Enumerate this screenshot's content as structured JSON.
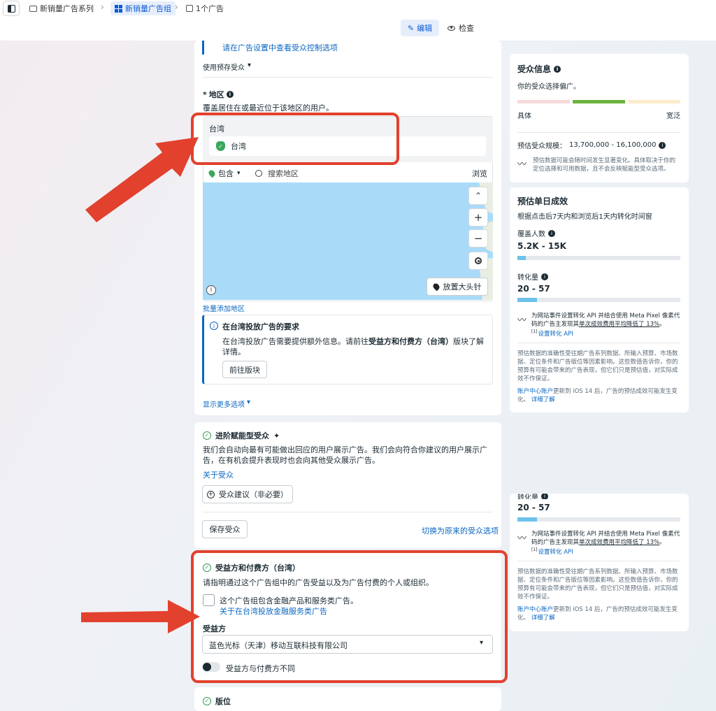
{
  "breadcrumb": {
    "campaign": "新销量广告系列",
    "adset": "新销量广告组",
    "ads": "1个广告"
  },
  "toolbar": {
    "edit": "编辑",
    "review": "检查"
  },
  "audience_top": {
    "link": "请在广告设置中查看受众控制选项",
    "saved": "使用预存受众"
  },
  "location": {
    "title": "地区",
    "required_mark": "*",
    "desc": "覆盖居住在或最近位于该地区的用户。",
    "group": "台湾",
    "item": "台湾",
    "include": "包含",
    "search_placeholder": "搜索地区",
    "browse": "浏览",
    "pin": "放置大头针",
    "bulk": "批量添加地区"
  },
  "notice": {
    "title": "在台湾投放广告的要求",
    "body_pre": "在台湾投放广告需要提供额外信息。请前往",
    "body_bold": "受益方和付费方（台湾）",
    "body_post": "版块了解详情。",
    "button": "前往版块"
  },
  "more_options": "显示更多选项",
  "advantage": {
    "title": "进阶赋能型受众",
    "desc": "我们会自动向最有可能做出回应的用户展示广告。我们会向符合你建议的用户展示广告，在有机会提升表现时也会向其他受众展示广告。",
    "about": "关于受众",
    "suggest": "受众建议（非必要）",
    "save": "保存受众",
    "switch": "切换为原来的受众选项"
  },
  "beneficiary": {
    "title": "受益方和付费方（台湾）",
    "desc": "请指明通过这个广告组中的广告受益以及为广告付费的个人或组织。",
    "checkbox": "这个广告组包含金融产品和服务类广告。",
    "fin_link": "关于在台湾投放金融服务类广告",
    "label": "受益方",
    "value": "蓝色光标（天津）移动互联科技有限公司",
    "toggle": "受益方与付费方不同"
  },
  "placement": {
    "title": "版位"
  },
  "audience_info": {
    "title": "受众信息",
    "desc": "你的受众选择偏广。",
    "narrow": "具体",
    "broad": "宽泛",
    "size_label": "预估受众规模：",
    "size_value": "13,700,000 - 16,100,000",
    "note": "预估数据可能会随时间发生显著变化。具体取决于你的定位选择和可用数据，且不会反映赋能型受众选项。"
  },
  "daily": {
    "title": "预估单日成效",
    "window": "根据点击后7天内和浏览后1天内转化时间窗",
    "reach_label": "覆盖人数",
    "reach_value": "5.2K - 15K",
    "reach_fill": 0.05,
    "conv_label": "转化量",
    "conv_value": "20 - 57",
    "conv_fill": 0.12,
    "api_pre": "为网站事件设置转化 API 并结合使用 Meta Pixel 像素代码的广告主发现其",
    "api_under": "单次成效费用平均降低了 13%",
    "api_post": "。",
    "api_ref": "[1]",
    "api_link": "设置转化 API",
    "disclaimer": "预估数据的准确性受往期广告系列数据、所输入预算、市场数据、定位条件和广告版位等因素影响。这些数值告诉你，你的预算有可能会带来的广告表现，但它们只是预估值，对实际成效不作保证。",
    "ios_link": "账户中心账户",
    "ios_mid": "更新到 iOS 14 后，广告的预估成效可能发生变化。",
    "ios_more": "详细了解"
  },
  "lower_clone": {
    "conv_label": "转化量",
    "conv_value": "20 - 57"
  },
  "colors": {
    "accent": "#0a66c2",
    "annotation": "#e2412e",
    "green": "#6db33f"
  }
}
